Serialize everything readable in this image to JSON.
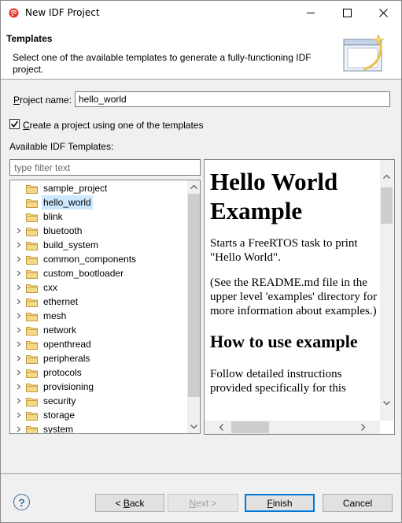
{
  "window": {
    "title": "New IDF Project"
  },
  "banner": {
    "title": "Templates",
    "description": "Select one of the available templates to generate a fully-functioning IDF project."
  },
  "form": {
    "project_name_label": "Project name:",
    "project_name_value": "hello_world",
    "use_template_label": "Create a project using one of the templates",
    "use_template_checked": true,
    "available_label": "Available IDF Templates:",
    "filter_placeholder": "type filter text"
  },
  "tree": {
    "items": [
      {
        "label": "sample_project",
        "expandable": false,
        "selected": false
      },
      {
        "label": "hello_world",
        "expandable": false,
        "selected": true
      },
      {
        "label": "blink",
        "expandable": false,
        "selected": false
      },
      {
        "label": "bluetooth",
        "expandable": true,
        "selected": false
      },
      {
        "label": "build_system",
        "expandable": true,
        "selected": false
      },
      {
        "label": "common_components",
        "expandable": true,
        "selected": false
      },
      {
        "label": "custom_bootloader",
        "expandable": true,
        "selected": false
      },
      {
        "label": "cxx",
        "expandable": true,
        "selected": false
      },
      {
        "label": "ethernet",
        "expandable": true,
        "selected": false
      },
      {
        "label": "mesh",
        "expandable": true,
        "selected": false
      },
      {
        "label": "network",
        "expandable": true,
        "selected": false
      },
      {
        "label": "openthread",
        "expandable": true,
        "selected": false
      },
      {
        "label": "peripherals",
        "expandable": true,
        "selected": false
      },
      {
        "label": "protocols",
        "expandable": true,
        "selected": false
      },
      {
        "label": "provisioning",
        "expandable": true,
        "selected": false
      },
      {
        "label": "security",
        "expandable": true,
        "selected": false
      },
      {
        "label": "storage",
        "expandable": true,
        "selected": false
      },
      {
        "label": "system",
        "expandable": true,
        "selected": false
      }
    ]
  },
  "preview": {
    "heading": "Hello World Example",
    "para1": "Starts a FreeRTOS task to print \"Hello World\".",
    "para2": "(See the README.md file in the upper level 'examples' directory for more information about examples.)",
    "heading2": "How to use example",
    "para3": "Follow detailed instructions provided specifically for this"
  },
  "buttons": {
    "help": "?",
    "back": "< Back",
    "next": "Next >",
    "finish": "Finish",
    "cancel": "Cancel"
  },
  "colors": {
    "selection": "#cce8ff",
    "folder": "#dcb35c",
    "default_button_border": "#0078d7"
  }
}
